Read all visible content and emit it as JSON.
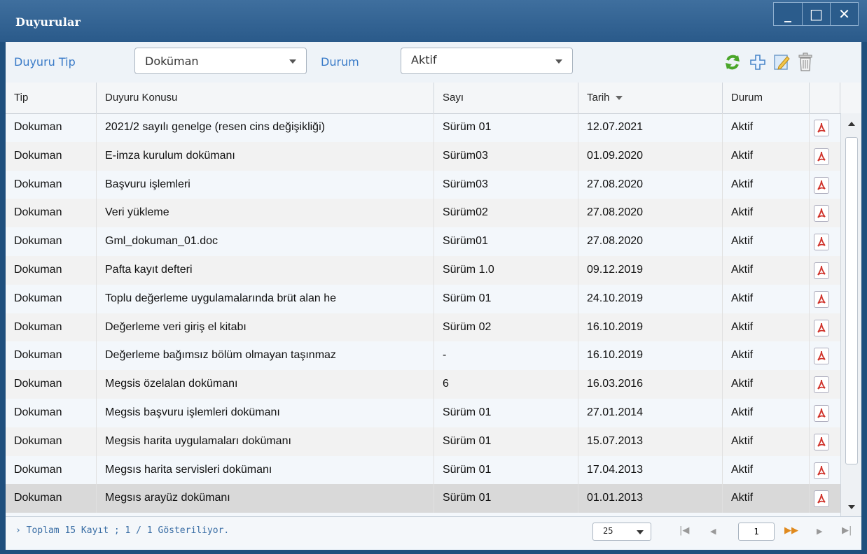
{
  "window": {
    "title": "Duyurular",
    "buttons": {
      "minimize": "_",
      "maximize": "□",
      "close": "✕"
    }
  },
  "toolbar": {
    "type_label": "Duyuru Tip",
    "type_value": "Doküman",
    "status_label": "Durum",
    "status_value": "Aktif",
    "icons": [
      "refresh-icon",
      "add-icon",
      "edit-icon",
      "delete-icon"
    ]
  },
  "grid": {
    "columns": [
      "Tip",
      "Duyuru Konusu",
      "Sayı",
      "Tarih",
      "Durum"
    ],
    "rows": [
      [
        "Dokuman",
        "2021/2 sayılı genelge (resen cins değişikliği)",
        "Sürüm 01",
        "12.07.2021",
        "Aktif"
      ],
      [
        "Dokuman",
        "E-imza kurulum dokümanı",
        "Sürüm03",
        "01.09.2020",
        "Aktif"
      ],
      [
        "Dokuman",
        "Başvuru işlemleri",
        "Sürüm03",
        "27.08.2020",
        "Aktif"
      ],
      [
        "Dokuman",
        "Veri yükleme",
        "Sürüm02",
        "27.08.2020",
        "Aktif"
      ],
      [
        "Dokuman",
        "Gml_dokuman_01.doc",
        "Sürüm01",
        "27.08.2020",
        "Aktif"
      ],
      [
        "Dokuman",
        "Pafta kayıt defteri",
        "Sürüm 1.0",
        "09.12.2019",
        "Aktif"
      ],
      [
        "Dokuman",
        "Toplu değerleme uygulamalarında brüt alan he",
        "Sürüm 01",
        "24.10.2019",
        "Aktif"
      ],
      [
        "Dokuman",
        "Değerleme veri giriş el kitabı",
        "Sürüm 02",
        "16.10.2019",
        "Aktif"
      ],
      [
        "Dokuman",
        "Değerleme bağımsız bölüm olmayan taşınmaz",
        "-",
        "16.10.2019",
        "Aktif"
      ],
      [
        "Dokuman",
        "Megsis özelalan dokümanı",
        "6",
        "16.03.2016",
        "Aktif"
      ],
      [
        "Dokuman",
        "Megsis başvuru işlemleri dokümanı",
        "Sürüm 01",
        "27.01.2014",
        "Aktif"
      ],
      [
        "Dokuman",
        "Megsis harita uygulamaları dokümanı",
        "Sürüm 01",
        "15.07.2013",
        "Aktif"
      ],
      [
        "Dokuman",
        "Megsıs harita servisleri dokümanı",
        "Sürüm 01",
        "17.04.2013",
        "Aktif"
      ],
      [
        "Dokuman",
        "Megsıs arayüz dokümanı",
        "Sürüm 01",
        "01.01.2013",
        "Aktif"
      ]
    ]
  },
  "footer": {
    "summary": "› Toplam 15 Kayıt ; 1 / 1 Gösteriliyor.",
    "page_size": "25",
    "page": "1"
  }
}
